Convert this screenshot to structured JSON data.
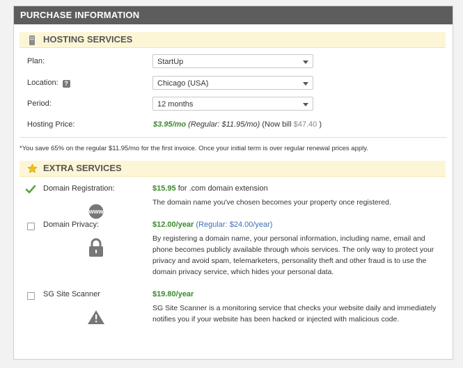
{
  "header": {
    "title": "PURCHASE INFORMATION"
  },
  "hosting": {
    "title": "HOSTING SERVICES",
    "plan": {
      "label": "Plan:",
      "value": "StartUp"
    },
    "location": {
      "label": "Location:",
      "value": "Chicago (USA)",
      "help": "?"
    },
    "period": {
      "label": "Period:",
      "value": "12 months"
    },
    "price": {
      "label": "Hosting Price:",
      "amount": "$3.95/mo",
      "regular": "(Regular: $11.95/mo)",
      "now_bill": "(Now bill",
      "bill_amount": "$47.40",
      "close": ")"
    },
    "note": "*You save 65% on the regular $11.95/mo for the first invoice. Once your initial term is over regular renewal prices apply."
  },
  "extra": {
    "title": "EXTRA SERVICES",
    "domain_registration": {
      "label": "Domain Registration:",
      "price": "$15.95",
      "price_suffix": "for .com domain extension",
      "description": "The domain name you've chosen becomes your property once registered.",
      "icon_text": "www"
    },
    "domain_privacy": {
      "label": "Domain Privacy:",
      "price": "$12.00/year",
      "regular": "(Regular: $24.00/year)",
      "description": "By registering a domain name, your personal information, including name, email and phone becomes publicly available through whois services. The only way to protect your privacy and avoid spam, telemarketers, personality theft and other fraud is to use the domain privacy service, which hides your personal data."
    },
    "site_scanner": {
      "label": "SG Site Scanner",
      "price": "$19.80/year",
      "description": "SG Site Scanner is a monitoring service that checks your website daily and immediately notifies you if your website has been hacked or injected with malicious code."
    }
  },
  "colors": {
    "header_bg": "#5d5d5d",
    "section_bg": "#fdf6d6",
    "price_green": "#3a8a2b",
    "link_blue": "#3c6fb5"
  }
}
